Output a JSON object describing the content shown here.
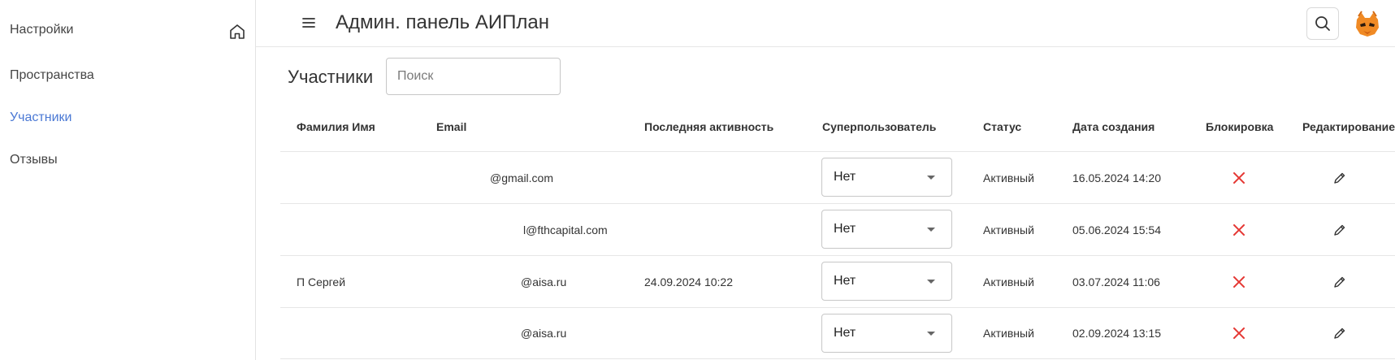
{
  "sidebar": {
    "items": [
      {
        "label": "Настройки",
        "active": false
      },
      {
        "label": "Пространства",
        "active": false
      },
      {
        "label": "Участники",
        "active": true
      },
      {
        "label": "Отзывы",
        "active": false
      }
    ],
    "home_icon": "home-icon"
  },
  "header": {
    "title": "Админ. панель АИПлан",
    "menu_icon": "hamburger-icon",
    "search_icon": "search-icon"
  },
  "page": {
    "section_title": "Участники",
    "search_placeholder": "Поиск"
  },
  "table": {
    "columns": [
      "Фамилия Имя",
      "Email",
      "Последняя активность",
      "Суперпользователь",
      "Статус",
      "Дата создания",
      "Блокировка",
      "Редактирование"
    ],
    "rows": [
      {
        "name": "",
        "email": "@gmail.com",
        "last_activity": "",
        "superuser": "Нет",
        "status": "Активный",
        "created": "16.05.2024 14:20"
      },
      {
        "name": "",
        "email": "l@fthcapital.com",
        "last_activity": "",
        "superuser": "Нет",
        "status": "Активный",
        "created": "05.06.2024 15:54"
      },
      {
        "name": "П Сергей",
        "email": "@aisa.ru",
        "last_activity": "24.09.2024 10:22",
        "superuser": "Нет",
        "status": "Активный",
        "created": "03.07.2024 11:06"
      },
      {
        "name": "",
        "email": "@aisa.ru",
        "last_activity": "",
        "superuser": "Нет",
        "status": "Активный",
        "created": "02.09.2024 13:15"
      }
    ]
  },
  "colors": {
    "accent": "#4a78d4",
    "block_icon": "#e53935"
  }
}
